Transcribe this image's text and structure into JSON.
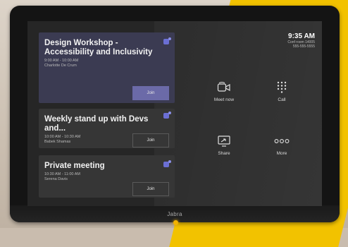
{
  "device": {
    "brand": "Jabra"
  },
  "status": {
    "time": "9:35 AM",
    "room": "Conf room 14005",
    "phone": "555-555-5555"
  },
  "meetings": [
    {
      "title": "Design Workshop - Accessibility and Inclusivity",
      "time": "9:00 AM - 10:00 AM",
      "organizer": "Charlotte De Crum",
      "action": "Join"
    },
    {
      "title": "Weekly stand up with Devs and...",
      "time": "10:00 AM - 10:30 AM",
      "organizer": "Babek Shamas",
      "action": "Join"
    },
    {
      "title": "Private meeting",
      "time": "10:30 AM - 11:00 AM",
      "organizer": "Serena Davis",
      "action": "Join"
    }
  ],
  "actions": [
    {
      "label": "Meet now",
      "icon": "video-camera-icon"
    },
    {
      "label": "Call",
      "icon": "dialpad-icon"
    },
    {
      "label": "Share",
      "icon": "screen-share-icon"
    },
    {
      "label": "More",
      "icon": "more-dots-icon"
    }
  ],
  "colors": {
    "accent_yellow": "#f2c200",
    "card_active": "#3b3b52",
    "card": "#363636",
    "join_primary": "#6b6aa8",
    "teams": "#6b6fd4"
  }
}
